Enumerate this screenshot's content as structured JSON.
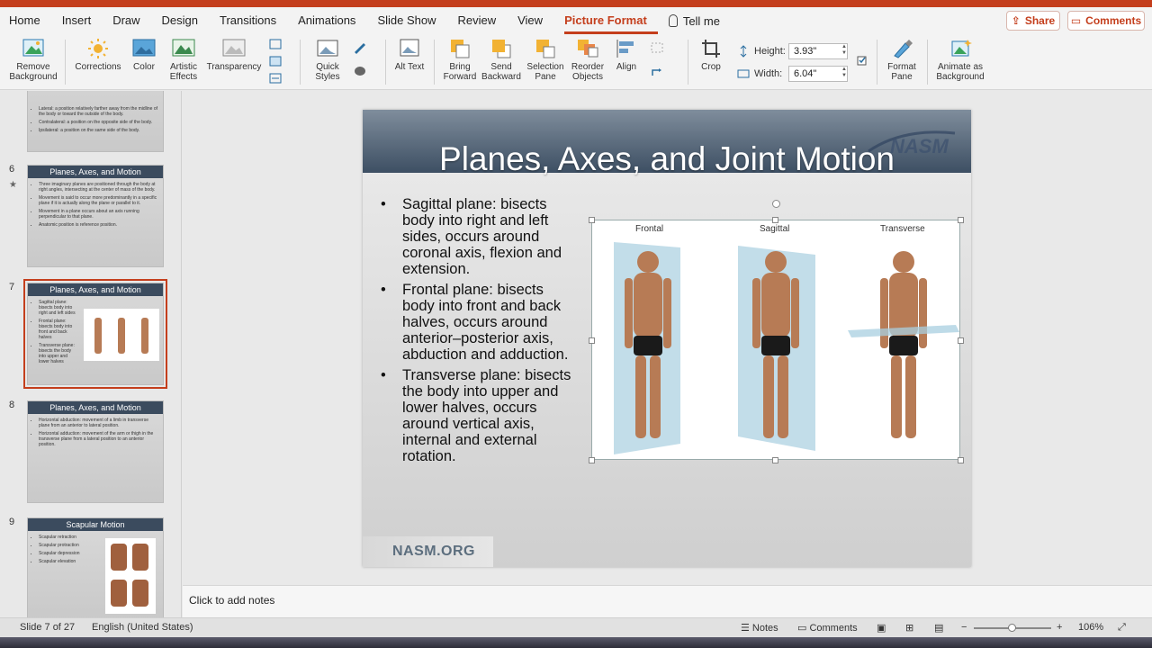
{
  "tabs": [
    "Home",
    "Insert",
    "Draw",
    "Design",
    "Transitions",
    "Animations",
    "Slide Show",
    "Review",
    "View",
    "Picture Format"
  ],
  "active_tab": "Picture Format",
  "tell_me": "Tell me",
  "share_label": "Share",
  "comments_label": "Comments",
  "ribbon": {
    "remove_bg": "Remove Background",
    "corrections": "Corrections",
    "color": "Color",
    "artistic": "Artistic Effects",
    "transparency": "Transparency",
    "quick_styles": "Quick Styles",
    "alt_text": "Alt Text",
    "bring_forward": "Bring Forward",
    "send_backward": "Send Backward",
    "selection_pane": "Selection Pane",
    "reorder": "Reorder Objects",
    "align": "Align",
    "crop": "Crop",
    "height_label": "Height:",
    "height_value": "3.93\"",
    "width_label": "Width:",
    "width_value": "6.04\"",
    "format_pane": "Format Pane",
    "animate_bg": "Animate as Background"
  },
  "thumbnails": [
    {
      "num": "",
      "title": "",
      "lines": [
        "Lateral: a position relatively farther away from the midline of the body or toward the outside of the body.",
        "Contralateral: a position on the opposite side of the body.",
        "Ipsilateral: a position on the same side of the body."
      ]
    },
    {
      "num": "6",
      "title": "Planes, Axes, and Motion",
      "lines": [
        "Three imaginary planes are positioned through the body at right angles, intersecting at the center of mass of the body.",
        "Movement is said to occur more predominantly in a specific plane if it is actually along the plane or parallel to it.",
        "Movement in a plane occurs about an axis running perpendicular to that plane.",
        "Anatomic position is reference position."
      ]
    },
    {
      "num": "7",
      "title": "Planes, Axes, and Motion",
      "lines": [
        "Sagittal plane: bisects body into right and left sides",
        "Frontal plane: bisects body into front and back halves",
        "Transverse plane: bisects the body into upper and lower halves"
      ]
    },
    {
      "num": "8",
      "title": "Planes, Axes, and Motion",
      "lines": [
        "Horizontal abduction: movement of a limb in transverse plane from an anterior to lateral position.",
        "Horizontal adduction: movement of the arm or thigh in the transverse plane from a lateral position to an anterior position."
      ]
    },
    {
      "num": "9",
      "title": "Scapular Motion",
      "lines": [
        "Scapular retraction",
        "Scapular protraction",
        "Scapular depression",
        "Scapular elevation"
      ]
    }
  ],
  "slide": {
    "title": "Planes, Axes, and Joint Motion",
    "logo": "NASM",
    "bullets": [
      "Sagittal plane: bisects body into right and left sides, occurs around coronal axis, flexion and extension.",
      "Frontal plane: bisects body into front and back halves, occurs around anterior–posterior axis, abduction and adduction.",
      "Transverse plane: bisects the body into upper and lower halves, occurs around vertical axis, internal and external rotation."
    ],
    "labels": [
      "Frontal",
      "Sagittal",
      "Transverse"
    ],
    "footer": "NASM.ORG"
  },
  "notes_placeholder": "Click to add notes",
  "status": {
    "slide_info": "Slide 7 of 27",
    "language": "English (United States)",
    "notes": "Notes",
    "comments": "Comments",
    "zoom": "106%"
  },
  "colors": {
    "accent": "#c43e1c",
    "slide_header": "#3d4f63"
  }
}
